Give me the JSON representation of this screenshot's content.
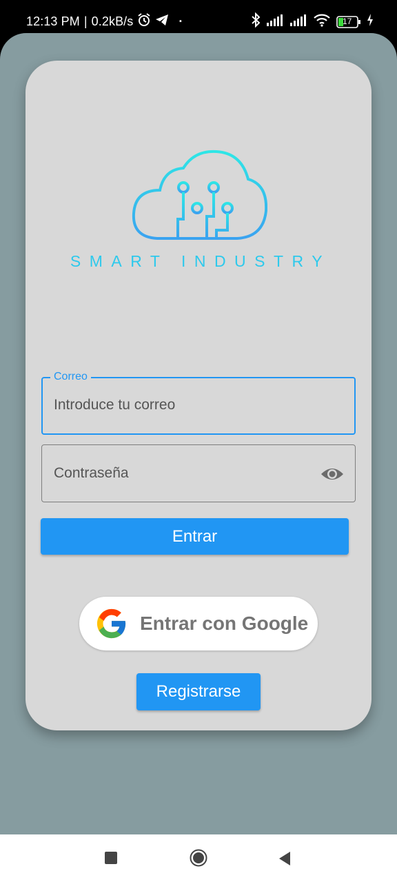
{
  "status_bar": {
    "time": "12:13 PM",
    "separator": "|",
    "net_speed": "0.2kB/s",
    "dot": "·",
    "battery": "17",
    "icons": [
      "alarm-icon",
      "telegram-icon",
      "bluetooth-icon",
      "signal-icon",
      "signal-icon",
      "wifi-icon",
      "battery-icon",
      "charging-icon"
    ]
  },
  "brand": {
    "name": "SMART INDUSTRY",
    "logo_icon": "cloud-circuit-icon",
    "color": "#2dc9ec"
  },
  "login_form": {
    "email": {
      "label": "Correo",
      "value": "Introduce tu correo"
    },
    "password": {
      "value": "Contraseña",
      "toggle_icon": "eye-icon"
    },
    "login_button": "Entrar",
    "google_button": "Entrar con Google",
    "register_button": "Registrarse"
  },
  "colors": {
    "accent": "#2196f3",
    "background": "#869ca0",
    "card": "#d8d8d8"
  },
  "nav_bar": {
    "icons": [
      "recent-apps-icon",
      "home-icon",
      "back-icon"
    ]
  }
}
